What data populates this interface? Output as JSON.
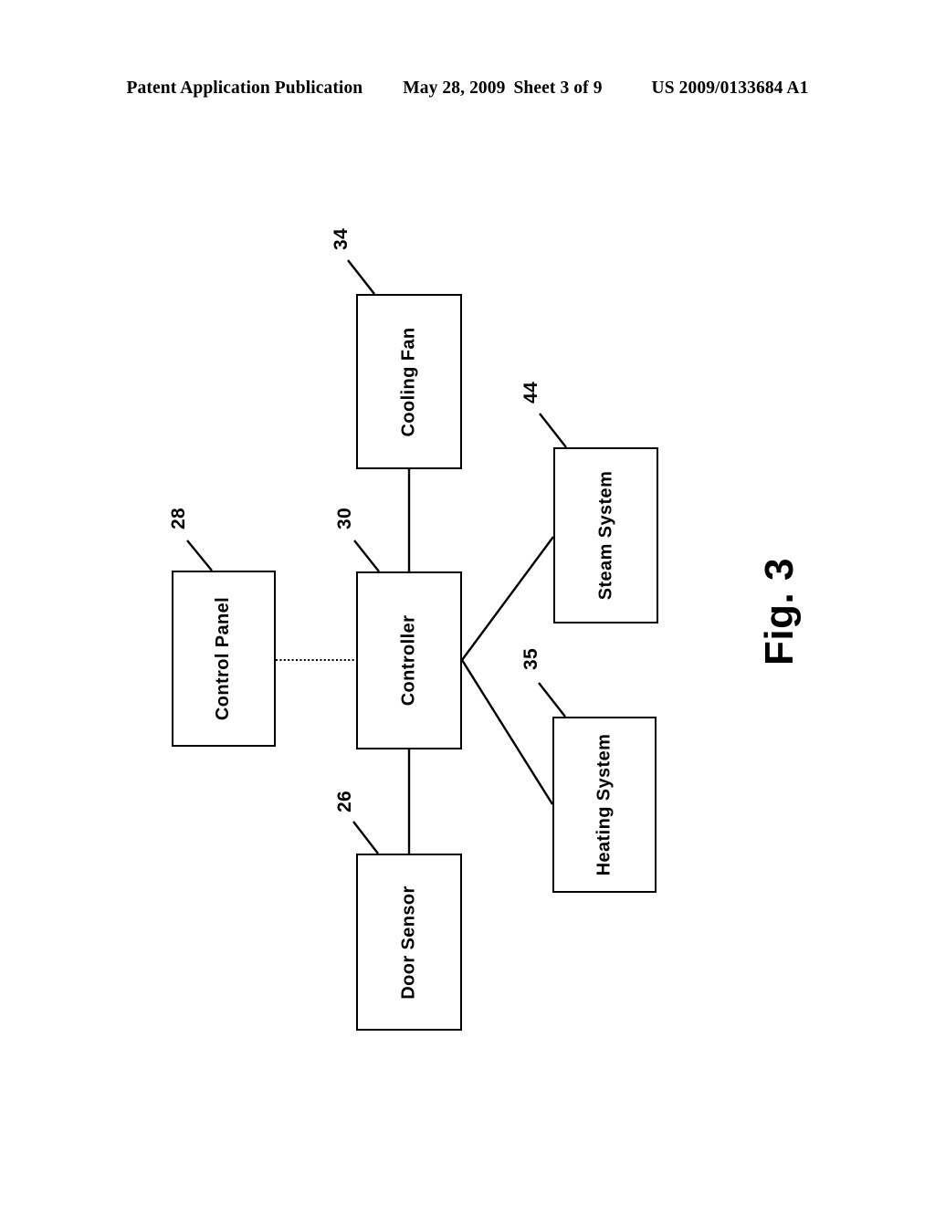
{
  "header": {
    "publication": "Patent Application Publication",
    "date": "May 28, 2009",
    "sheet": "Sheet 3 of 9",
    "patent_number": "US 2009/0133684 A1"
  },
  "figure": {
    "caption": "Fig. 3",
    "type": "block-diagram",
    "blocks": [
      {
        "id": "cooling-fan",
        "label": "Cooling Fan",
        "ref": "34"
      },
      {
        "id": "control-panel",
        "label": "Control Panel",
        "ref": "28"
      },
      {
        "id": "controller",
        "label": "Controller",
        "ref": "30"
      },
      {
        "id": "door-sensor",
        "label": "Door Sensor",
        "ref": "26"
      },
      {
        "id": "steam-system",
        "label": "Steam System",
        "ref": "44"
      },
      {
        "id": "heating-system",
        "label": "Heating System",
        "ref": "35"
      }
    ],
    "connections": [
      {
        "from": "controller",
        "to": "cooling-fan",
        "style": "solid"
      },
      {
        "from": "controller",
        "to": "door-sensor",
        "style": "solid"
      },
      {
        "from": "controller",
        "to": "control-panel",
        "style": "dotted"
      },
      {
        "from": "controller",
        "to": "steam-system",
        "style": "solid"
      },
      {
        "from": "controller",
        "to": "heating-system",
        "style": "solid"
      }
    ],
    "colors": {
      "stroke": "#000000",
      "background": "#ffffff"
    }
  }
}
